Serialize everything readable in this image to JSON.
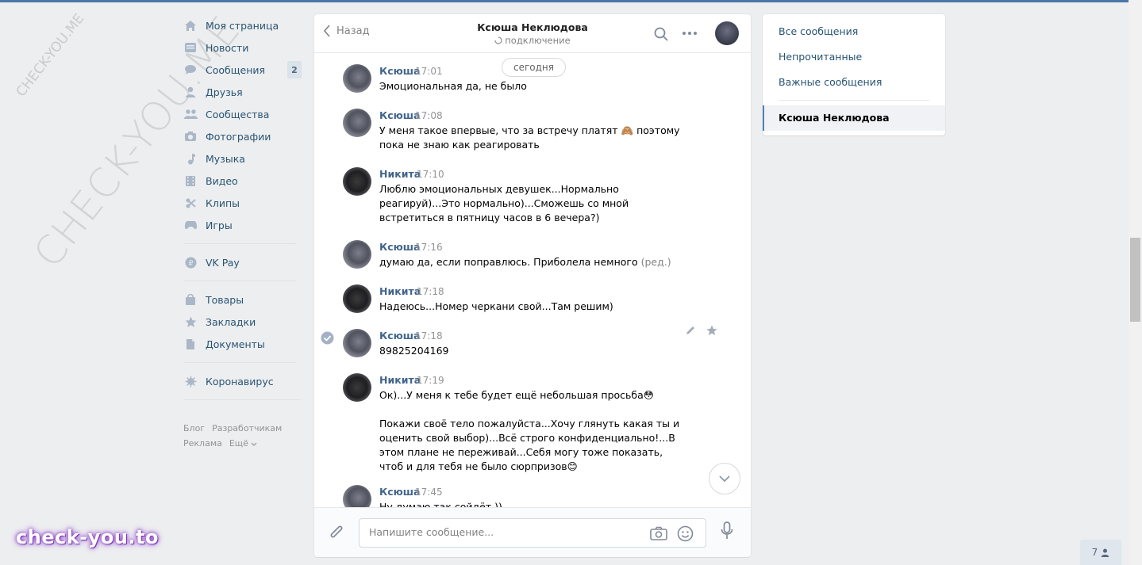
{
  "watermarks": {
    "large": "CHECK-YOU.ME",
    "small": "CHECK-YOU.ME",
    "brand": "check-you.to"
  },
  "nav": {
    "items": [
      {
        "label": "Моя страница",
        "icon": "home-icon"
      },
      {
        "label": "Новости",
        "icon": "news-icon"
      },
      {
        "label": "Сообщения",
        "icon": "messages-icon",
        "badge": "2"
      },
      {
        "label": "Друзья",
        "icon": "friend-icon"
      },
      {
        "label": "Сообщества",
        "icon": "groups-icon"
      },
      {
        "label": "Фотографии",
        "icon": "camera-icon"
      },
      {
        "label": "Музыка",
        "icon": "music-icon"
      },
      {
        "label": "Видео",
        "icon": "video-icon"
      },
      {
        "label": "Клипы",
        "icon": "clips-icon"
      },
      {
        "label": "Игры",
        "icon": "games-icon"
      }
    ],
    "pay": {
      "label": "VK Pay",
      "icon": "vkpay-icon"
    },
    "items2": [
      {
        "label": "Товары",
        "icon": "market-icon"
      },
      {
        "label": "Закладки",
        "icon": "star-icon"
      },
      {
        "label": "Документы",
        "icon": "document-icon"
      }
    ],
    "corona": {
      "label": "Коронавирус",
      "icon": "virus-icon"
    },
    "footer": {
      "blog": "Блог",
      "dev": "Разработчикам",
      "ads": "Реклама",
      "more": "Ещё"
    }
  },
  "chat": {
    "back_label": "Назад",
    "title": "Ксюша Неклюдова",
    "status": "подключение",
    "day_label": "сегодня",
    "messages": [
      {
        "author": "Ксюша",
        "time": "17:01",
        "text": "Эмоциональная да, не было"
      },
      {
        "author": "Ксюша",
        "time": "17:08",
        "text": "У меня такое впервые, что за встречу платят 🙈 поэтому пока не знаю как реагировать"
      },
      {
        "author": "Никита",
        "time": "17:10",
        "text": "Люблю эмоциональных девушек...Нормально реагируй)...Это нормально)...Сможешь со мной встретиться в пятницу часов в 6 вечера?)"
      },
      {
        "author": "Ксюша",
        "time": "17:16",
        "text": "думаю да, если поправлюсь. Приболела немного",
        "edited": "(ред.)"
      },
      {
        "author": "Никита",
        "time": "17:18",
        "text": "Надеюсь...Номер черкани свой...Там решим)"
      },
      {
        "author": "Ксюша",
        "time": "17:18",
        "text": "89825204169"
      },
      {
        "author": "Никита",
        "time": "17:19",
        "text": "Ок)...У меня к тебе будет ещё небольшая просьба😳\n\nПокажи своё тело пожалуйста...Хочу глянуть какая ты и оценить свой выбор)...Всё строго конфиденциально!...В этом плане не переживай...Себя могу тоже показать, чтоб и для тебя не было сюрпризов😊"
      },
      {
        "author": "Ксюша",
        "time": "17:45",
        "text": "Ну думаю так сойдёт ))"
      }
    ],
    "composer_placeholder": "Напишите сообщение..."
  },
  "right_panel": {
    "all": "Все сообщения",
    "unread": "Непрочитанные",
    "important": "Важные сообщения",
    "active": "Ксюша Неклюдова"
  },
  "online_count": "7",
  "colors": {
    "accent": "#4a76a8",
    "link": "#285473",
    "author": "#42648b",
    "page_bg": "#edeef0"
  }
}
